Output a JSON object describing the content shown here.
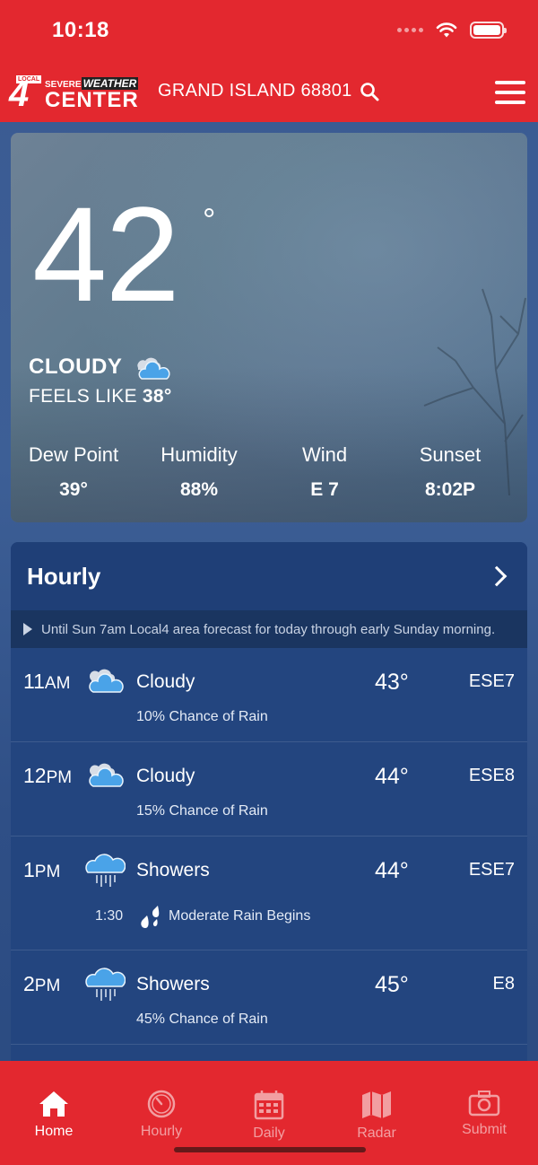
{
  "status_bar": {
    "time": "10:18"
  },
  "header": {
    "logo": {
      "local": "LOCAL",
      "number": "4",
      "severe": "SEVERE",
      "weather": "WEATHER",
      "center": "CENTER"
    },
    "location": "GRAND ISLAND 68801"
  },
  "current": {
    "temperature": "42",
    "degree_symbol": "°",
    "condition": "CLOUDY",
    "feels_like_label": "FEELS LIKE",
    "feels_like_value": "38°",
    "stats": [
      {
        "label": "Dew Point",
        "value": "39°"
      },
      {
        "label": "Humidity",
        "value": "88%"
      },
      {
        "label": "Wind",
        "value": "E 7"
      },
      {
        "label": "Sunset",
        "value": "8:02P"
      }
    ]
  },
  "hourly": {
    "title": "Hourly",
    "notice": "Until Sun 7am  Local4 area forecast for today through early Sunday morning.",
    "rows": [
      {
        "hour": "11",
        "ampm": "AM",
        "icon": "cloudy-icon",
        "condition": "Cloudy",
        "temp": "43°",
        "wind": "ESE7",
        "sub": "10% Chance of Rain"
      },
      {
        "hour": "12",
        "ampm": "PM",
        "icon": "cloudy-icon",
        "condition": "Cloudy",
        "temp": "44°",
        "wind": "ESE8",
        "sub": "15% Chance of Rain"
      },
      {
        "hour": "1",
        "ampm": "PM",
        "icon": "showers-icon",
        "condition": "Showers",
        "temp": "44°",
        "wind": "ESE7",
        "event_time": "1:30",
        "event_icon": "raindrops-icon",
        "event_text": "Moderate Rain Begins"
      },
      {
        "hour": "2",
        "ampm": "PM",
        "icon": "showers-icon",
        "condition": "Showers",
        "temp": "45°",
        "wind": "E8",
        "sub": "45% Chance of Rain"
      }
    ]
  },
  "nav": [
    {
      "label": "Home",
      "icon": "home-icon",
      "active": true
    },
    {
      "label": "Hourly",
      "icon": "clock-icon",
      "active": false
    },
    {
      "label": "Daily",
      "icon": "calendar-icon",
      "active": false
    },
    {
      "label": "Radar",
      "icon": "map-icon",
      "active": false
    },
    {
      "label": "Submit",
      "icon": "camera-icon",
      "active": false
    }
  ],
  "colors": {
    "brand_red": "#e3282f",
    "card_blue": "#23457f",
    "icon_blue": "#4aa3e8"
  }
}
